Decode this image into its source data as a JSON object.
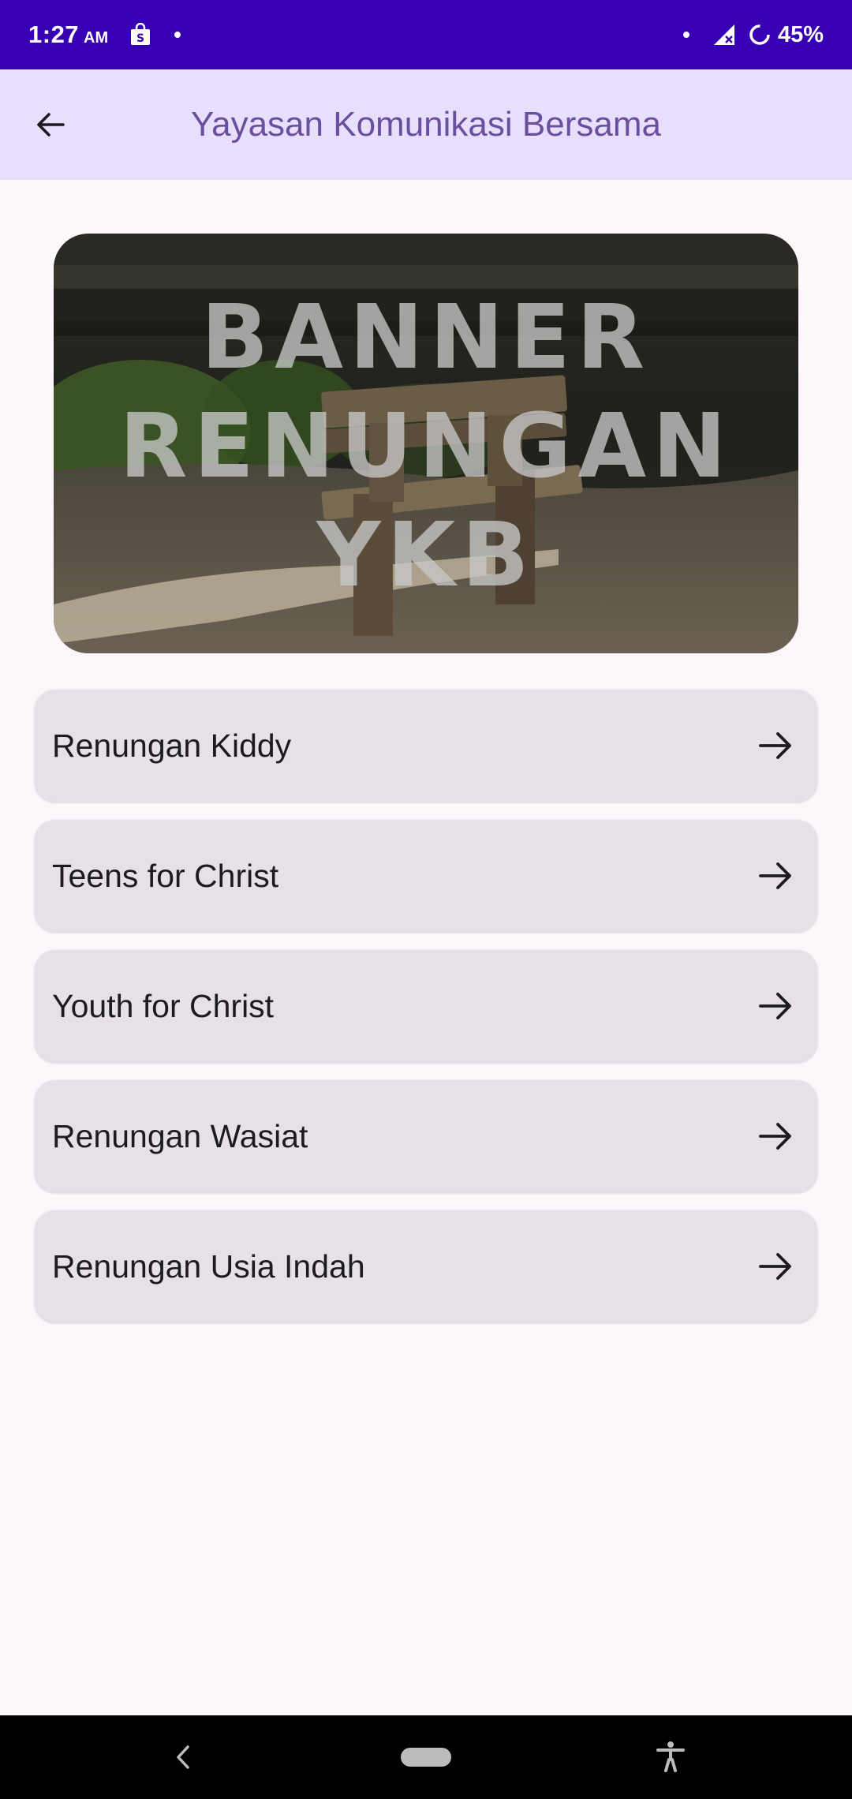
{
  "status_bar": {
    "time": "1:27",
    "ampm": "AM",
    "battery_percent": "45%",
    "icons": [
      "shopping-bag-icon",
      "notification-dot-icon",
      "signal-icon",
      "battery-saver-icon"
    ]
  },
  "app_bar": {
    "title": "Yayasan Komunikasi Bersama",
    "back_icon": "arrow-left-icon"
  },
  "banner": {
    "lines": [
      "BANNER",
      "RENUNGAN",
      "YKB"
    ]
  },
  "menu": {
    "items": [
      {
        "label": "Renungan Kiddy"
      },
      {
        "label": "Teens for Christ"
      },
      {
        "label": "Youth for Christ"
      },
      {
        "label": "Renungan Wasiat"
      },
      {
        "label": "Renungan Usia Indah"
      }
    ],
    "item_icon": "arrow-right-icon"
  },
  "colors": {
    "status_bar": "#3700b3",
    "app_bar": "#e8dffc",
    "title": "#6a4fa0",
    "background": "#fdf7fc",
    "card": "#e6e0e8"
  }
}
